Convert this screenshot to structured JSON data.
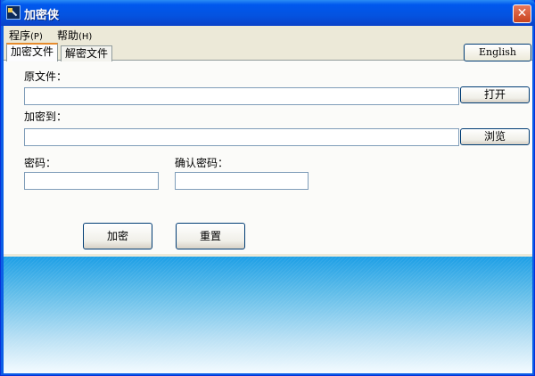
{
  "window": {
    "title": "加密侠",
    "close_symbol": "✕"
  },
  "menu": {
    "items": [
      {
        "label": "程序",
        "accel": "(P)"
      },
      {
        "label": "帮助",
        "accel": "(H)"
      }
    ]
  },
  "tabs": [
    {
      "label": "加密文件",
      "active": true
    },
    {
      "label": "解密文件",
      "active": false
    }
  ],
  "language_button": "English",
  "form": {
    "source_label": "原文件：",
    "source_value": "",
    "open_button": "打开",
    "dest_label": "加密到：",
    "dest_value": "",
    "browse_button": "浏览",
    "password_label": "密码：",
    "password_value": "",
    "confirm_label": "确认密码：",
    "confirm_value": ""
  },
  "actions": {
    "encrypt_button": "加密",
    "reset_button": "重置"
  },
  "colors": {
    "titlebar": "#0058ee",
    "client_bg": "#ece9d8",
    "banner_top": "#1d9fe6",
    "banner_bottom": "#f4fbff"
  }
}
